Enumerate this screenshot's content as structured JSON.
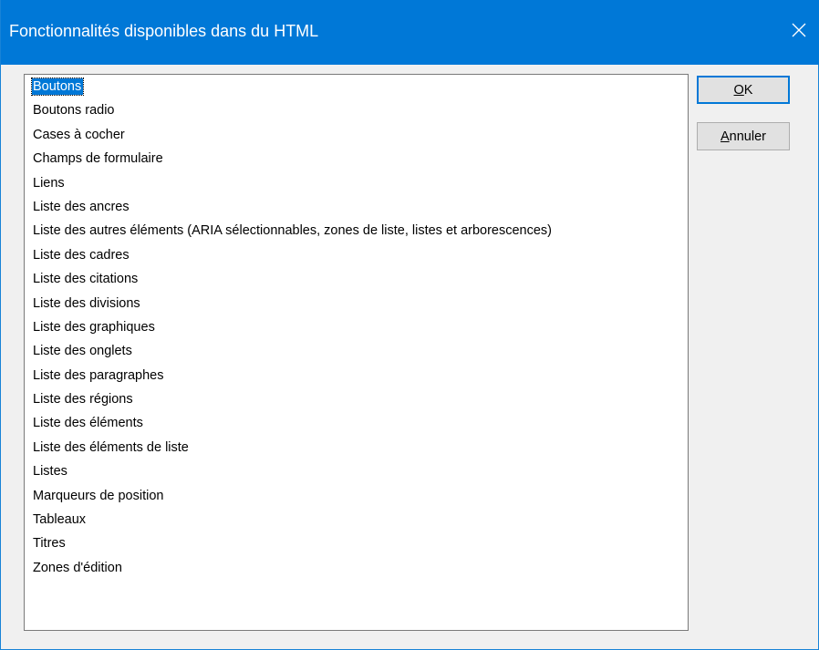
{
  "window": {
    "title": "Fonctionnalités disponibles dans du HTML"
  },
  "icons": {
    "close": "close-icon"
  },
  "colors": {
    "titlebar": "#0078d7",
    "selection": "#0078d7",
    "dialog_background": "#f0f0f0"
  },
  "list": {
    "selected_index": 0,
    "items": [
      "Boutons",
      "Boutons radio",
      "Cases à cocher",
      "Champs de formulaire",
      "Liens",
      "Liste des ancres",
      "Liste des autres éléments (ARIA sélectionnables, zones de liste, listes et arborescences)",
      "Liste des cadres",
      "Liste des citations",
      "Liste des divisions",
      "Liste des graphiques",
      "Liste des onglets",
      "Liste des paragraphes",
      "Liste des régions",
      "Liste des éléments",
      "Liste des éléments de liste",
      "Listes",
      "Marqueurs de position",
      "Tableaux",
      "Titres",
      "Zones d'édition"
    ]
  },
  "buttons": {
    "ok": {
      "accel": "O",
      "rest": "K"
    },
    "cancel": {
      "accel": "A",
      "rest": "nnuler"
    }
  }
}
